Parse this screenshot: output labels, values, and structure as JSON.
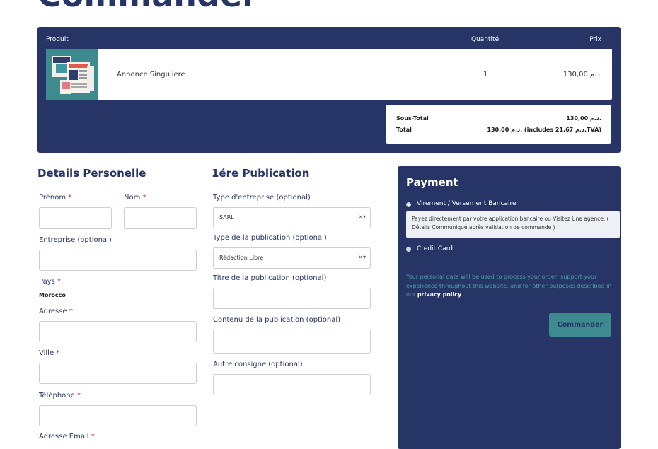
{
  "page": {
    "title": "Commander"
  },
  "cart": {
    "headers": {
      "product": "Produit",
      "quantity": "Quantité",
      "price": "Prix"
    },
    "item": {
      "name": "Annonce Singuliere",
      "quantity": "1",
      "price": "130,00 د.م."
    },
    "totals": {
      "subtotal_label": "Sous-Total",
      "subtotal_value": "130,00 د.م.",
      "total_label": "Total",
      "total_value": "130,00 د.م. (includes 21,67 د.م.TVA)"
    }
  },
  "personal": {
    "title": "Details Personelle",
    "first_name_label": "Prénom",
    "last_name_label": "Nom",
    "company_label": "Entreprise (optional)",
    "country_label": "Pays",
    "country_value": "Morocco",
    "address_label": "Adresse",
    "city_label": "Ville",
    "phone_label": "Téléphone",
    "email_label": "Adresse Email",
    "required_mark": "*"
  },
  "publication": {
    "title": "1ére Publication",
    "company_type_label": "Type d'entreprise (optional)",
    "company_type_value": "SARL",
    "pub_type_label": "Type de la publication (optional)",
    "pub_type_value": "Rédaction Libre",
    "pub_title_label": "Titre de la publication (optional)",
    "content_label": "Contenu de la publication (optional)",
    "other_label": "Autre consigne (optional)",
    "clear_glyph": "×▾"
  },
  "payment": {
    "title": "Payment",
    "option_bank": "Virement / Versement Bancaire",
    "option_bank_desc": "Payez directement par votre application bancaire ou Visitez Une agence. ( Détails Communiqué après validation de commande )",
    "option_card": "Credit Card",
    "privacy_text": "Your personal data will be used to process your order, support your experience throughout this website, and for other purposes described in our",
    "privacy_link": "privacy policy",
    "submit_label": "Commander"
  },
  "colors": {
    "navy": "#263566",
    "teal": "#3d8a8f",
    "required": "#e02020"
  }
}
